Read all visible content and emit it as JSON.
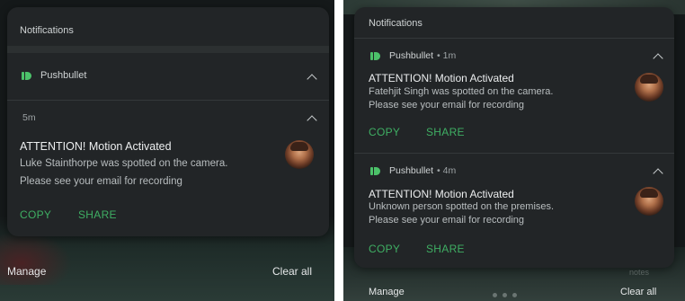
{
  "left": {
    "header": "Notifications",
    "app": {
      "name": "Pushbullet"
    },
    "notification": {
      "time": "5m",
      "title": "ATTENTION! Motion Activated",
      "line1": "Luke Stainthorpe was spotted on the camera.",
      "line2": "Please see your email for recording",
      "actions": {
        "copy": "COPY",
        "share": "SHARE"
      }
    },
    "footer": {
      "manage": "Manage",
      "clear_all": "Clear all"
    }
  },
  "right": {
    "header": "Notifications",
    "notifications": [
      {
        "app": "Pushbullet",
        "time": "• 1m",
        "title": "ATTENTION! Motion Activated",
        "line1": "Fatehjit Singh was spotted on the camera.",
        "line2": "Please see your email for recording",
        "actions": {
          "copy": "COPY",
          "share": "SHARE"
        }
      },
      {
        "app": "Pushbullet",
        "time": "• 4m",
        "title": "ATTENTION! Motion Activated",
        "line1": "Unknown person spotted on the premises.",
        "line2": "Please see your email for recording",
        "actions": {
          "copy": "COPY",
          "share": "SHARE"
        }
      }
    ],
    "background_label": "notes",
    "footer": {
      "manage": "Manage",
      "clear_all": "Clear all"
    }
  },
  "colors": {
    "panel": "#222527",
    "screen": "#15191a",
    "accent_green": "#3fae63",
    "app_icon_green": "#4cc26a"
  },
  "icons": [
    "pushbullet-app-icon",
    "chevron-up-icon",
    "avatar-photo"
  ]
}
